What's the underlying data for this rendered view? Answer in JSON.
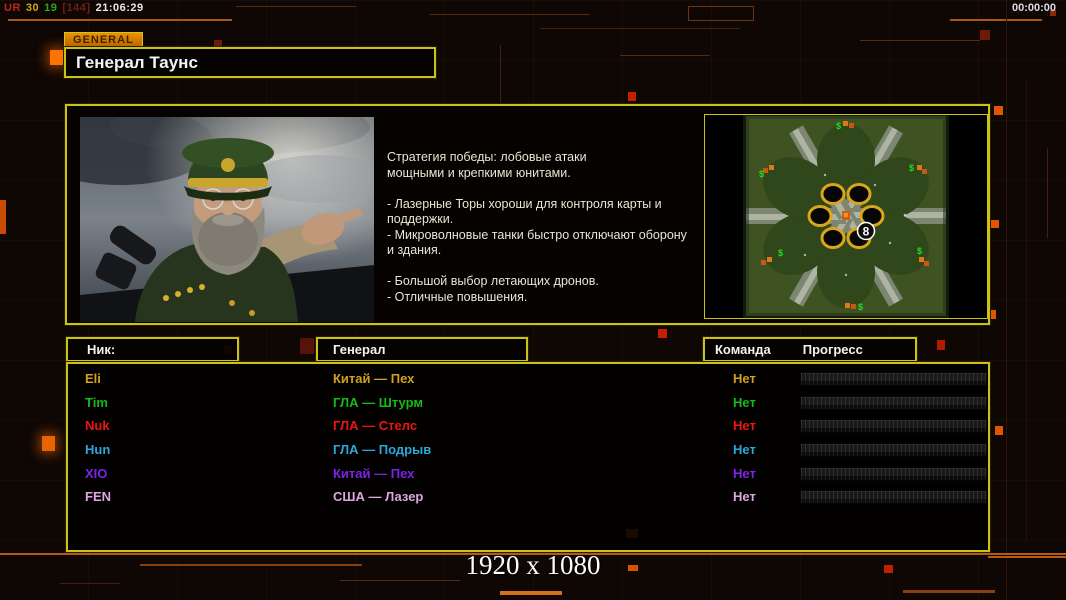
{
  "status_bar": {
    "label_ur": "UR",
    "value_a": "30",
    "value_b": "19",
    "value_bracket": "[144]",
    "clock": "21:06:29",
    "match_timer": "00:00:00"
  },
  "header": {
    "tab_label": "GENERAL",
    "general_title": "Генерал Таунс"
  },
  "briefing": {
    "strategy_text": "Стратегия победы: лобовые атаки\nмощными и крепкими юнитами.\n\n- Лазерные Торы хороши для контроля карты и\nподдержки.\n- Микроволновые танки быстро отключают оборону\nи здания.\n\n- Большой выбор летающих дронов.\n- Отличные повышения."
  },
  "minimap": {
    "start_label": "8",
    "resource_symbol": "$"
  },
  "roster": {
    "headers": {
      "nick": "Ник:",
      "general": "Генерал",
      "team": "Команда",
      "progress": "Прогресс"
    },
    "rows": [
      {
        "nick": "Eli",
        "general": "Китай — Пех",
        "team": "Нет",
        "color": "#cfa11c"
      },
      {
        "nick": "Tim",
        "general": "ГЛА — Штурм",
        "team": "Нет",
        "color": "#16b916"
      },
      {
        "nick": "Nuk",
        "general": "ГЛА — Стелс",
        "team": "Нет",
        "color": "#ee1515"
      },
      {
        "nick": "Hun",
        "general": "ГЛА — Подрыв",
        "team": "Нет",
        "color": "#2da6d8"
      },
      {
        "nick": "XIO",
        "general": "Китай — Пех",
        "team": "Нет",
        "color": "#7d22e8"
      },
      {
        "nick": "FEN",
        "general": "США — Лазер",
        "team": "Нет",
        "color": "#dca6de"
      }
    ]
  },
  "footer": {
    "resolution": "1920 x 1080"
  },
  "colors": {
    "accent_yellow": "#c9c411",
    "accent_orange": "#ff7300",
    "status_red": "#c41f00"
  }
}
